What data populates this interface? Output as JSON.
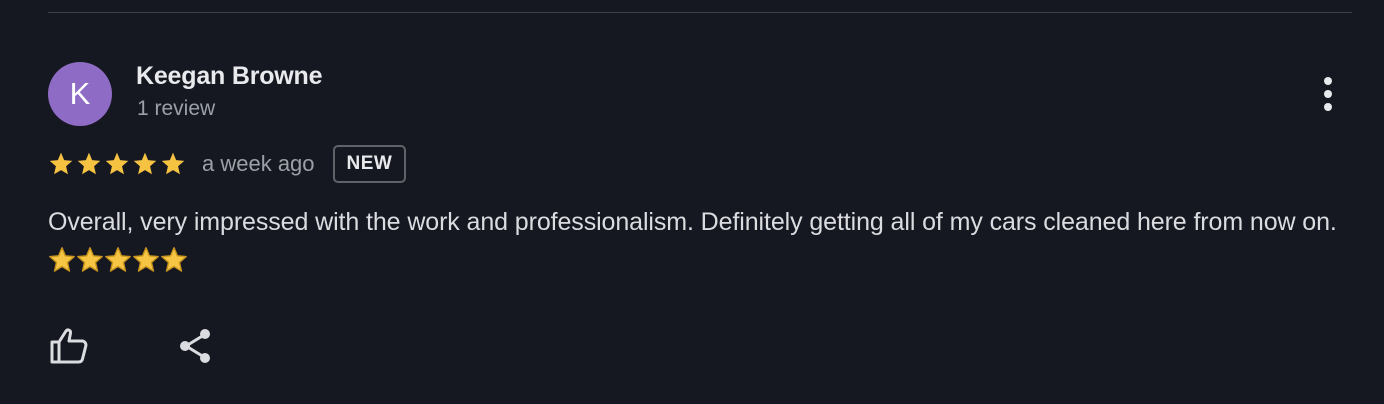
{
  "review": {
    "author_initial": "K",
    "author_name": "Keegan Browne",
    "review_count": "1 review",
    "rating": 5,
    "rating_max": 5,
    "time_ago": "a week ago",
    "badge": "NEW",
    "text": "Overall, very impressed with the work and professionalism. Definitely getting all of my cars cleaned here from now on.",
    "text_emoji_stars": 5
  },
  "icons": {
    "more": "more-vert-icon",
    "star": "star-icon",
    "like": "thumb-up-icon",
    "share": "share-icon"
  },
  "colors": {
    "background": "#161821",
    "avatar": "#8e6cc6",
    "star": "#f5c242",
    "secondary_text": "#9aa0a6",
    "badge_border": "#5f6368"
  }
}
